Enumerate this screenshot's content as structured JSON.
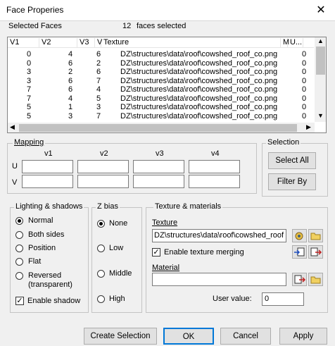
{
  "window": {
    "title": "Face Properies",
    "close_glyph": "✕"
  },
  "selected_faces": {
    "label": "Selected Faces",
    "count": "12",
    "text": "faces selected"
  },
  "table": {
    "columns": [
      "V1",
      "V2",
      "V3",
      "V",
      "Texture",
      "M",
      "U..."
    ],
    "rows": [
      [
        "0",
        "4",
        "6",
        "",
        "DZ\\structures\\data\\roof\\cowshed_roof_co.png",
        "",
        "0"
      ],
      [
        "0",
        "6",
        "2",
        "",
        "DZ\\structures\\data\\roof\\cowshed_roof_co.png",
        "",
        "0"
      ],
      [
        "3",
        "2",
        "6",
        "",
        "DZ\\structures\\data\\roof\\cowshed_roof_co.png",
        "",
        "0"
      ],
      [
        "3",
        "6",
        "7",
        "",
        "DZ\\structures\\data\\roof\\cowshed_roof_co.png",
        "",
        "0"
      ],
      [
        "7",
        "6",
        "4",
        "",
        "DZ\\structures\\data\\roof\\cowshed_roof_co.png",
        "",
        "0"
      ],
      [
        "7",
        "4",
        "5",
        "",
        "DZ\\structures\\data\\roof\\cowshed_roof_co.png",
        "",
        "0"
      ],
      [
        "5",
        "1",
        "3",
        "",
        "DZ\\structures\\data\\roof\\cowshed_roof_co.png",
        "",
        "0"
      ],
      [
        "5",
        "3",
        "7",
        "",
        "DZ\\structures\\data\\roof\\cowshed_roof_co.png",
        "",
        "0"
      ]
    ]
  },
  "mapping": {
    "label": "Mapping",
    "cols": [
      "v1",
      "v2",
      "v3",
      "v4"
    ],
    "rows": [
      "U",
      "V"
    ]
  },
  "selection": {
    "label": "Selection",
    "select_all": "Select All",
    "filter_by": "Filter By"
  },
  "lighting": {
    "label": "Lighting & shadows",
    "options": [
      "Normal",
      "Both sides",
      "Position",
      "Flat",
      "Reversed (transparent)"
    ],
    "selected": "Normal",
    "enable_shadow": "Enable shadow"
  },
  "zbias": {
    "label": "Z bias",
    "options": [
      "None",
      "Low",
      "Middle",
      "High"
    ],
    "selected": "None"
  },
  "texture": {
    "group_label": "Texture & materials",
    "texture_label": "Texture",
    "texture_value": "DZ\\structures\\data\\roof\\cowshed_roof",
    "enable_merging": "Enable texture merging",
    "material_label": "Material",
    "material_value": "",
    "user_value_label": "User value:",
    "user_value": "0"
  },
  "buttons": {
    "create_selection": "Create Selection",
    "ok": "OK",
    "cancel": "Cancel",
    "apply": "Apply"
  }
}
